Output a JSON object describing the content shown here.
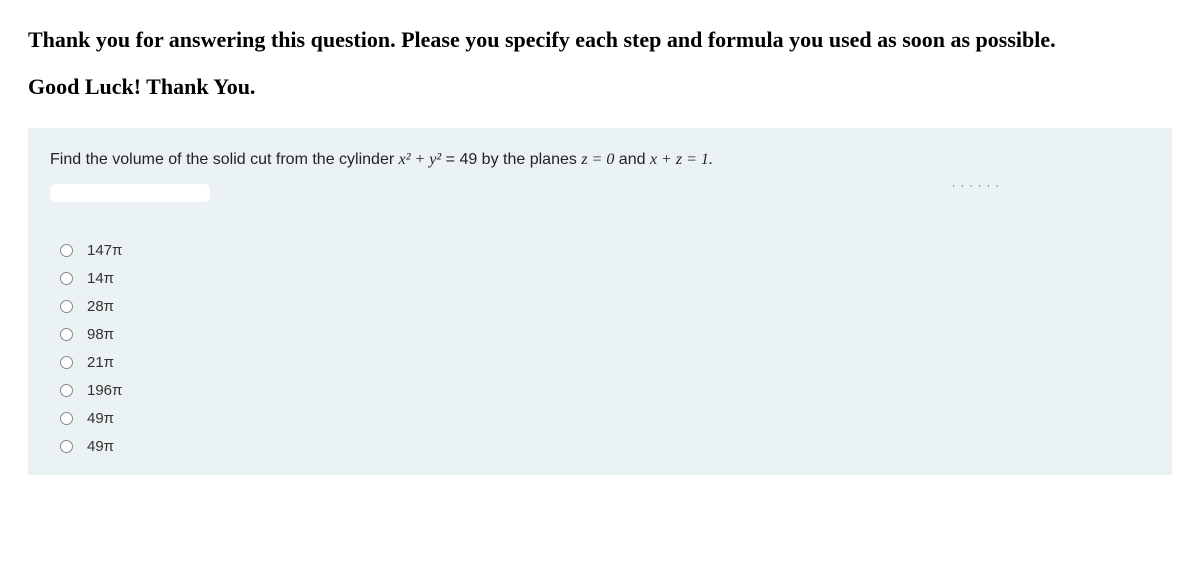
{
  "intro_line1": "Thank you for answering this question. Please you specify each step and formula you used as soon as possible.",
  "goodluck": "Good Luck! Thank You.",
  "question_pre": "Find the volume of the solid cut from the cylinder ",
  "question_eq1_lhs": "x² + y²",
  "question_eq1_rhs": " = 49",
  "question_mid": " by the planes ",
  "question_eq2": "z = 0",
  "question_and": " and ",
  "question_eq3": "x + z = 1.",
  "smudge": "· · ·   ·  ·  ·",
  "options": [
    {
      "label": "147π"
    },
    {
      "label": "14π"
    },
    {
      "label": "28π"
    },
    {
      "label": "98π"
    },
    {
      "label": "21π"
    },
    {
      "label": "196π"
    },
    {
      "label": "49π"
    },
    {
      "label": "49π"
    }
  ]
}
